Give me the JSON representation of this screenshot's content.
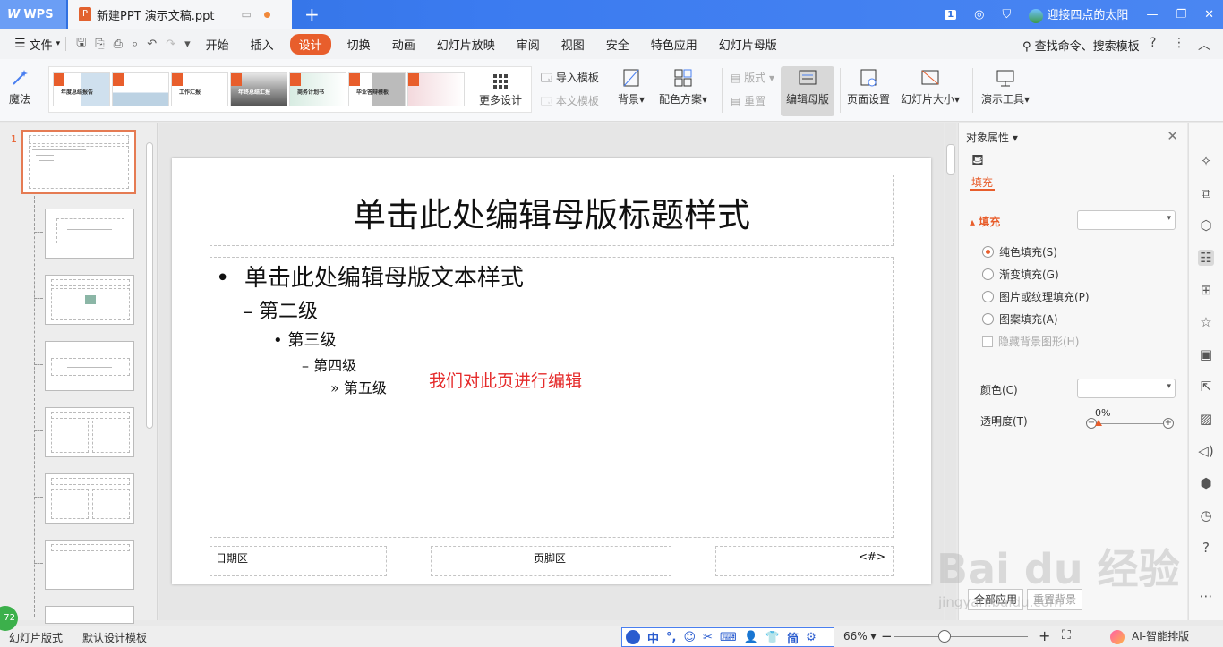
{
  "titlebar": {
    "app": "WPS",
    "doc_tab": "新建PPT 演示文稿.ppt",
    "user": "迎接四点的太阳",
    "badge": "1"
  },
  "menu": {
    "file": "文件",
    "items": [
      "开始",
      "插入",
      "设计",
      "切换",
      "动画",
      "幻灯片放映",
      "审阅",
      "视图",
      "安全",
      "特色应用",
      "幻灯片母版"
    ],
    "active": "设计",
    "search": "查找命令、搜索模板"
  },
  "ribbon": {
    "magic": "魔法",
    "themes": [
      "年度总结报告",
      "工作汇报",
      "年终总结汇报",
      "商务计划书",
      "毕业答辩模板",
      "",
      "",
      ""
    ],
    "more_design": "更多设计",
    "import_template": "导入模板",
    "this_template": "本文模板",
    "background": "背景",
    "color_scheme": "配色方案",
    "layout": "版式",
    "reset": "重置",
    "edit_master": "编辑母版",
    "page_setup": "页面设置",
    "slide_size": "幻灯片大小",
    "presenter_tools": "演示工具"
  },
  "thumbnails": {
    "current_number": "1",
    "master_title": "单击此处编辑母版标题样式"
  },
  "slide": {
    "title": "单击此处编辑母版标题样式",
    "levels": [
      "单击此处编辑母版文本样式",
      "第二级",
      "第三级",
      "第四级",
      "第五级"
    ],
    "bullets": [
      "•",
      "–",
      "•",
      "–",
      "»"
    ],
    "note": "我们对此页进行编辑",
    "footer_date": "日期区",
    "footer_center": "页脚区",
    "footer_number": "<#>"
  },
  "properties": {
    "header": "对象属性",
    "tab": "填充",
    "section": "填充",
    "options": [
      "纯色填充(S)",
      "渐变填充(G)",
      "图片或纹理填充(P)",
      "图案填充(A)"
    ],
    "hide_bg": "隐藏背景图形(H)",
    "color_label": "颜色(C)",
    "transparency_label": "透明度(T)",
    "transparency_value": "0%",
    "apply_all": "全部应用",
    "reset_bg": "重置背景"
  },
  "status": {
    "mode": "幻灯片版式",
    "design": "默认设计模板",
    "zoom": "66%",
    "ai": "AI-智能排版",
    "ime": [
      "中",
      "°,",
      "☺",
      "✂",
      "⌨",
      "👤",
      "👕",
      "简",
      "⚙"
    ],
    "green_ball": "72"
  },
  "watermark": {
    "logo": "Bai du 经验",
    "url": "jingyan.baidu.com"
  }
}
